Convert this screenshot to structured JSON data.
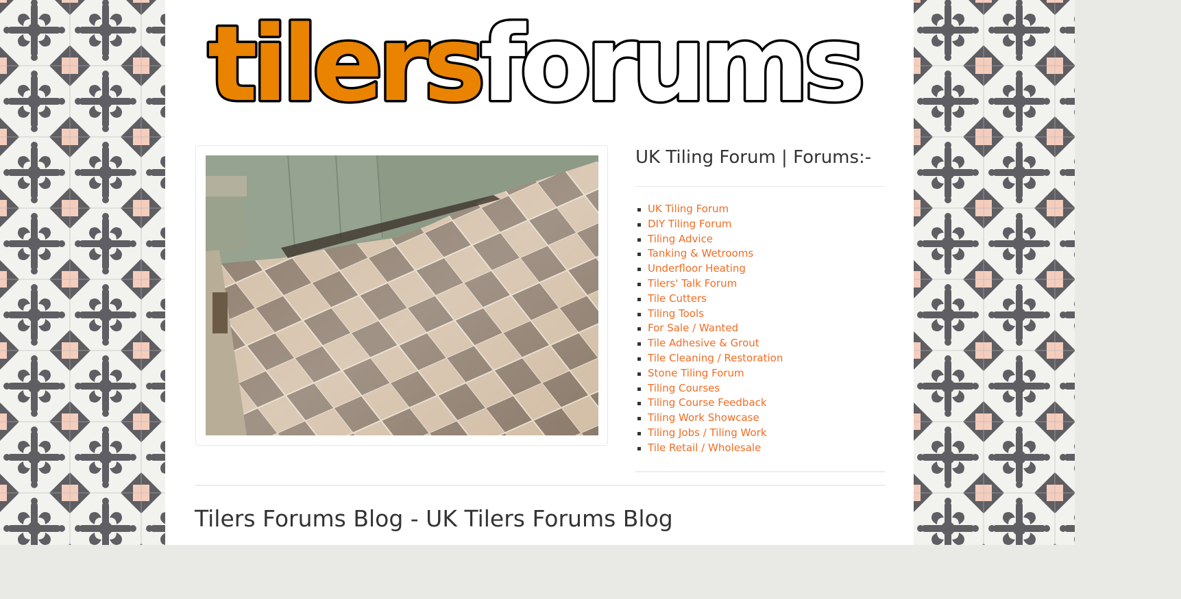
{
  "site": {
    "logo": {
      "part1": "tilers",
      "part2": "forums",
      "accent": "#e98300"
    },
    "link_color": "#f26c23"
  },
  "hero_image": {
    "alt": "Checkerboard stone tile floor"
  },
  "sidebar": {
    "title": "UK Tiling Forum | Forums:-",
    "forums": [
      "UK Tiling Forum",
      "DIY Tiling Forum",
      "Tiling Advice",
      "Tanking & Wetrooms",
      "Underfloor Heating",
      "Tilers' Talk Forum",
      "Tile Cutters",
      "Tiling Tools",
      "For Sale / Wanted",
      "Tile Adhesive & Grout",
      "Tile Cleaning / Restoration",
      "Stone Tiling Forum",
      "Tiling Courses",
      "Tiling Course Feedback",
      "Tiling Work Showcase",
      "Tiling Jobs / Tiling Work",
      "Tile Retail / Wholesale"
    ]
  },
  "blog": {
    "title": "Tilers Forums Blog - UK Tilers Forums Blog"
  }
}
